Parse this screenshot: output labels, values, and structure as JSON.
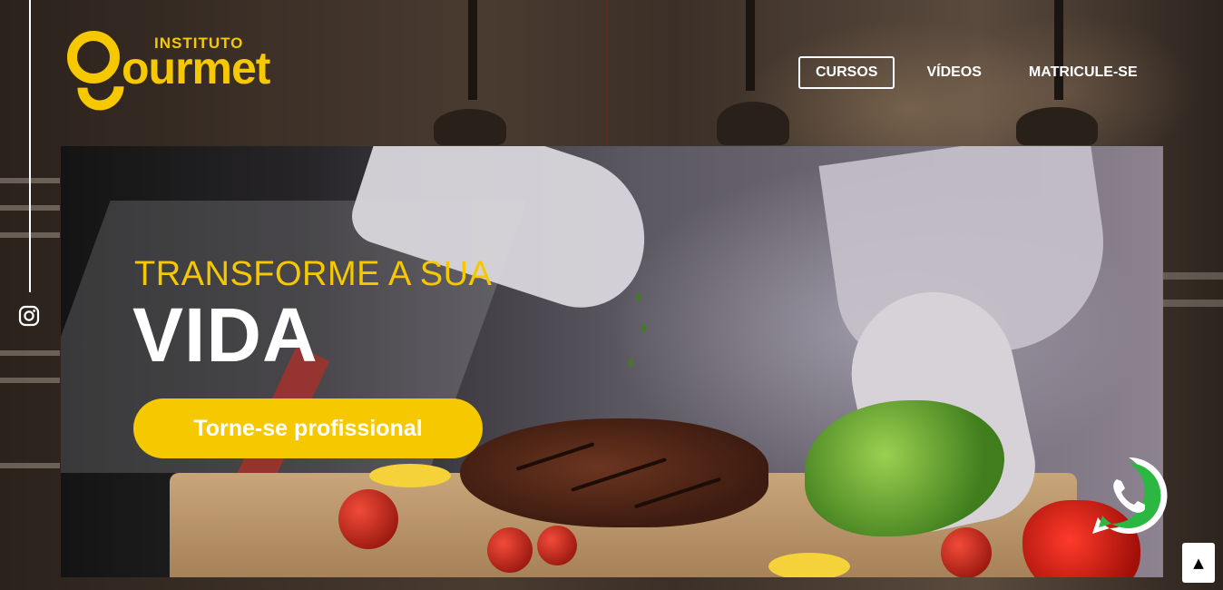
{
  "brand": {
    "small": "INSTITUTO",
    "big": "ourmet",
    "color": "#f6c800"
  },
  "nav": {
    "items": [
      "CURSOS",
      "VÍDEOS",
      "MATRICULE-SE"
    ],
    "active": "CURSOS"
  },
  "social": {
    "icon": "instagram-icon"
  },
  "hero": {
    "subtitle": "TRANSFORME A SUA",
    "title": "VIDA",
    "cta": "Torne-se profissional"
  },
  "floating": {
    "whatsapp_icon": "whatsapp-icon",
    "scroll_top": "▲"
  },
  "colors": {
    "accent": "#f6c800",
    "white": "#ffffff"
  }
}
